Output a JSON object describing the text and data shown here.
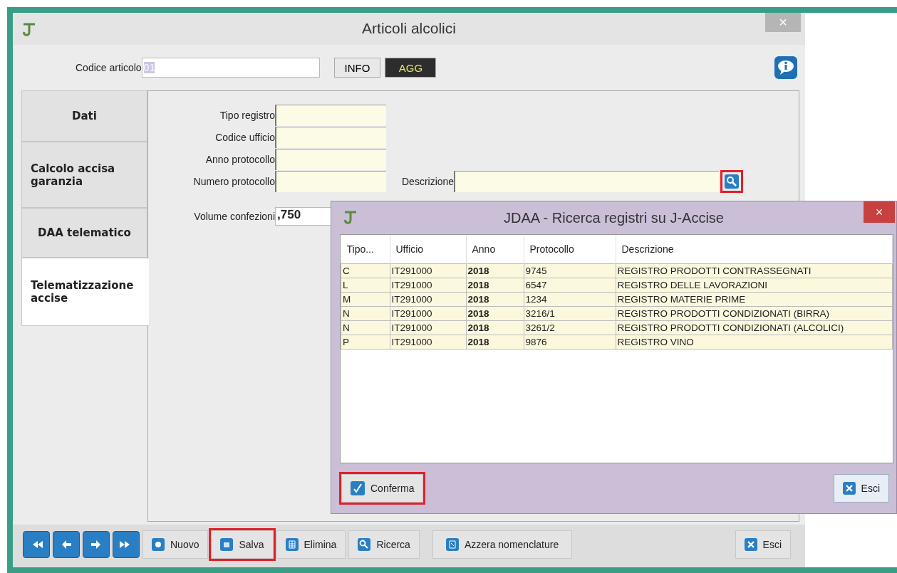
{
  "window": {
    "title": "Articoli alcolici",
    "close": "×"
  },
  "article": {
    "label": "Codice articolo",
    "value": "01",
    "buttons": [
      {
        "label": "INFO",
        "kind": "plain"
      },
      {
        "label": "AGG",
        "kind": "dark"
      }
    ]
  },
  "tabs": [
    {
      "label": "Dati",
      "selected": false
    },
    {
      "label": "Calcolo accisa garanzia",
      "selected": false
    },
    {
      "label": "DAA telematico",
      "selected": false
    },
    {
      "label": "Telematizzazione accise",
      "selected": true
    }
  ],
  "form": {
    "fields": [
      {
        "label": "Tipo registro"
      },
      {
        "label": "Codice ufficio"
      },
      {
        "label": "Anno protocollo"
      },
      {
        "label": "Numero protocollo"
      }
    ],
    "description_label": "Descrizione",
    "search_highlighted": true,
    "volume_label": "Volume confezioni",
    "volume_value": ",750"
  },
  "dialog": {
    "title": "JDAA - Ricerca registri su J-Accise",
    "close": "×",
    "columns": [
      "Tipo...",
      "Ufficio",
      "Anno",
      "Protocollo",
      "Descrizione"
    ],
    "rows": [
      [
        "C",
        "IT291000",
        "2018",
        "9745",
        "REGISTRO PRODOTTI CONTRASSEGNATI"
      ],
      [
        "L",
        "IT291000",
        "2018",
        "6547",
        "REGISTRO DELLE LAVORAZIONI"
      ],
      [
        "M",
        "IT291000",
        "2018",
        "1234",
        "REGISTRO MATERIE PRIME"
      ],
      [
        "N",
        "IT291000",
        "2018",
        "3216/1",
        "REGISTRO PRODOTTI CONDIZIONATI (BIRRA)"
      ],
      [
        "N",
        "IT291000",
        "2018",
        "3261/2",
        "REGISTRO PRODOTTI CONDIZIONATI (ALCOLICI)"
      ],
      [
        "P",
        "IT291000",
        "2018",
        "9876",
        "REGISTRO VINO"
      ]
    ],
    "confirm": {
      "label": "Conferma",
      "highlighted": true
    },
    "exit": {
      "label": "Esci",
      "highlighted": false
    }
  },
  "toolbar": {
    "nav": [
      {
        "kind": "first"
      },
      {
        "kind": "prev"
      },
      {
        "kind": "next"
      },
      {
        "kind": "last"
      }
    ],
    "buttons": [
      {
        "label": "Nuovo",
        "kind": "new",
        "highlighted": false
      },
      {
        "label": "Salva",
        "kind": "save",
        "highlighted": true
      },
      {
        "label": "Elimina",
        "kind": "delete",
        "highlighted": false
      },
      {
        "label": "Ricerca",
        "kind": "search",
        "highlighted": false
      },
      {
        "label": "Azzera nomenclature",
        "kind": "reset",
        "highlighted": false
      }
    ],
    "exit": {
      "label": "Esci",
      "highlighted": false
    }
  }
}
